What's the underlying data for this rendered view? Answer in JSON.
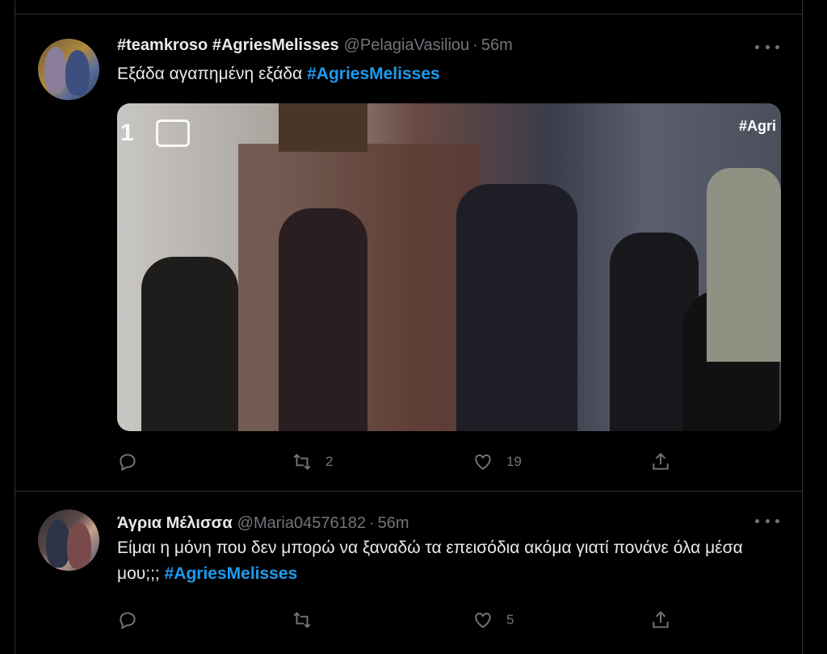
{
  "tweets": [
    {
      "name": "#teamkroso #AgriesMelisses",
      "handle": "@PelagiaVasiliou",
      "separator": "·",
      "time": "56m",
      "text": "Εξάδα αγαπημένη εξάδα",
      "hashtag": "#AgriesMelisses",
      "media": {
        "channel_logo": "1",
        "overlay_tag": "#Agri"
      },
      "replies": "",
      "retweets": "2",
      "likes": "19"
    },
    {
      "name": "Άγρια Μέλισσα",
      "handle": "@Maria04576182",
      "separator": "·",
      "time": "56m",
      "text": "Είμαι η μόνη που δεν μπορώ να ξαναδώ τα επεισόδια ακόμα γιατί πονάνε όλα μέσα μου;;;",
      "hashtag": "#AgriesMelisses",
      "replies": "",
      "retweets": "",
      "likes": "5"
    }
  ],
  "icons": {
    "reply": "reply-icon",
    "retweet": "retweet-icon",
    "like": "heart-icon",
    "share": "share-icon",
    "more": "more-icon"
  },
  "colors": {
    "background": "#000000",
    "text": "#e7e9ea",
    "muted": "#71767b",
    "hashtag": "#1d9bf0",
    "divider": "#2f3336"
  }
}
